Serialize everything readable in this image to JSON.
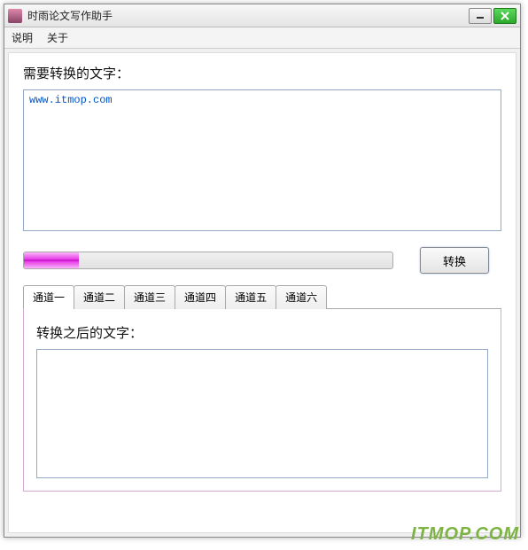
{
  "window": {
    "title": "时雨论文写作助手"
  },
  "menu": {
    "items": [
      "说明",
      "关于"
    ]
  },
  "input": {
    "label": "需要转换的文字：",
    "value": "www.itmop.com"
  },
  "convert": {
    "label": "转换"
  },
  "progress": {
    "percent": 15
  },
  "tabs": {
    "items": [
      "通道一",
      "通道二",
      "通道三",
      "通道四",
      "通道五",
      "通道六"
    ],
    "active_index": 0
  },
  "output": {
    "label": "转换之后的文字：",
    "value": ""
  },
  "watermark": "ITMOP.COM"
}
